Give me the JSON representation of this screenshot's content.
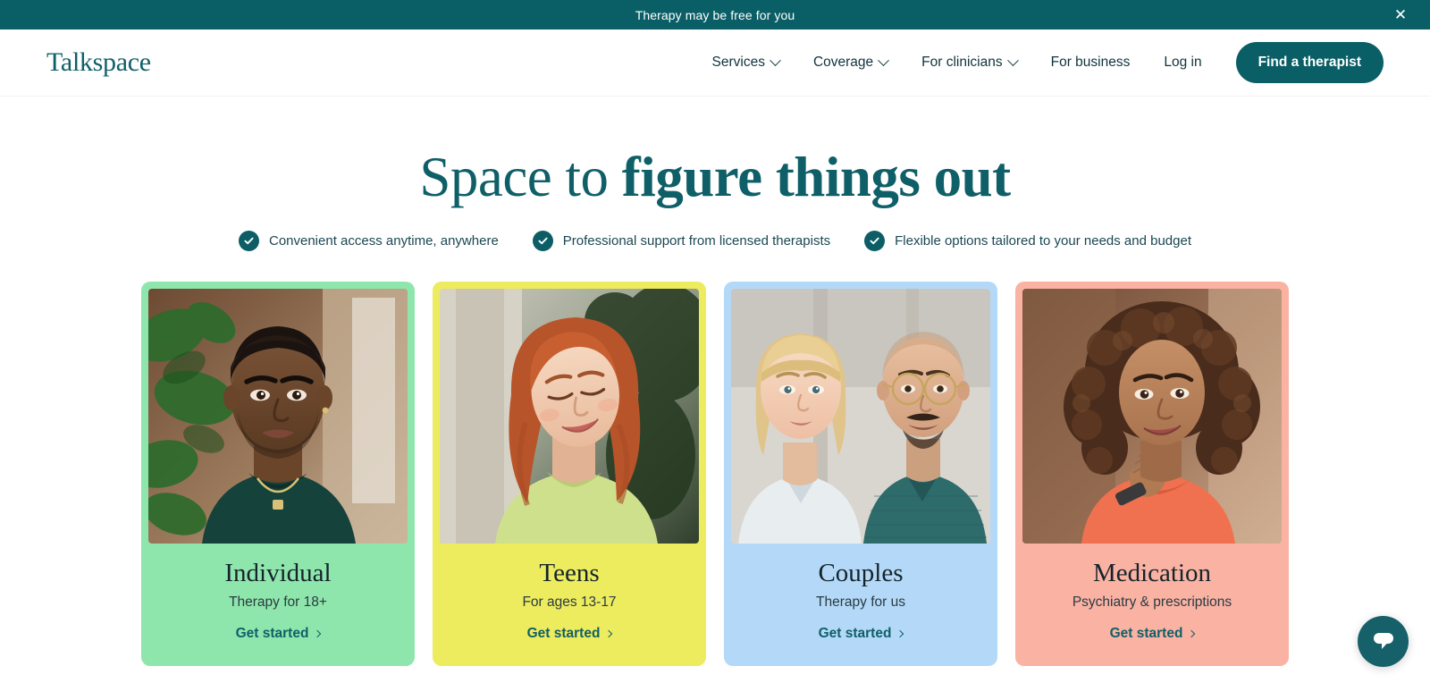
{
  "banner": {
    "text": "Therapy may be free for you",
    "close_label": "✕"
  },
  "header": {
    "logo": "Talkspace",
    "nav": [
      {
        "label": "Services",
        "has_chevron": true
      },
      {
        "label": "Coverage",
        "has_chevron": true
      },
      {
        "label": "For clinicians",
        "has_chevron": true
      },
      {
        "label": "For business",
        "has_chevron": false
      },
      {
        "label": "Log in",
        "has_chevron": false
      }
    ],
    "cta_label": "Find a therapist"
  },
  "hero": {
    "title_regular": "Space to ",
    "title_bold": "figure things out",
    "benefits": [
      "Convenient access anytime, anywhere",
      "Professional support from licensed therapists",
      "Flexible options tailored to your needs and budget"
    ]
  },
  "cards": [
    {
      "title": "Individual",
      "subtitle": "Therapy for 18+",
      "link": "Get started",
      "bg": "#8fe6ac",
      "photo_alt": "man-portrait-photo"
    },
    {
      "title": "Teens",
      "subtitle": "For ages 13-17",
      "link": "Get started",
      "bg": "#edeb5e",
      "photo_alt": "teen-girl-portrait-photo"
    },
    {
      "title": "Couples",
      "subtitle": "Therapy for us",
      "link": "Get started",
      "bg": "#b4d9f8",
      "photo_alt": "couple-portrait-photo"
    },
    {
      "title": "Medication",
      "subtitle": "Psychiatry & prescriptions",
      "link": "Get started",
      "bg": "#fab2a3",
      "photo_alt": "woman-portrait-photo"
    }
  ],
  "chat": {
    "label": "chat-bubble-icon"
  },
  "colors": {
    "brand_teal": "#0a5f66",
    "heading_teal": "#0f5f68",
    "text_dark": "#15242b"
  }
}
